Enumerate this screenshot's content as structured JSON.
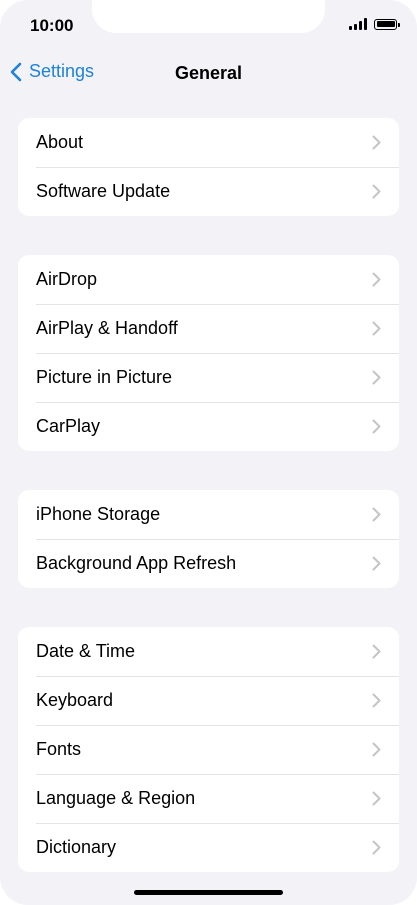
{
  "status_bar": {
    "time": "10:00"
  },
  "nav": {
    "back_label": "Settings",
    "title": "General"
  },
  "groups": [
    {
      "items": [
        {
          "label": "About"
        },
        {
          "label": "Software Update"
        }
      ]
    },
    {
      "items": [
        {
          "label": "AirDrop"
        },
        {
          "label": "AirPlay & Handoff"
        },
        {
          "label": "Picture in Picture"
        },
        {
          "label": "CarPlay"
        }
      ]
    },
    {
      "items": [
        {
          "label": "iPhone Storage"
        },
        {
          "label": "Background App Refresh"
        }
      ]
    },
    {
      "items": [
        {
          "label": "Date & Time"
        },
        {
          "label": "Keyboard"
        },
        {
          "label": "Fonts"
        },
        {
          "label": "Language & Region"
        },
        {
          "label": "Dictionary"
        }
      ]
    }
  ],
  "colors": {
    "accent": "#1e82d7",
    "background": "#f2f2f7",
    "chevron": "#c4c4c7"
  },
  "icons": {
    "back": "chevron-left-icon",
    "row": "chevron-right-icon",
    "signal": "cellular-signal-icon",
    "battery": "battery-icon"
  }
}
